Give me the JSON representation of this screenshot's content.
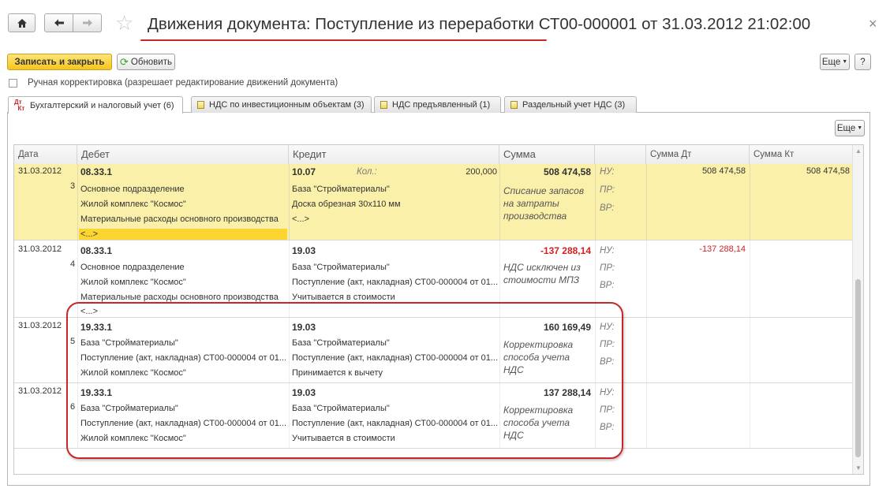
{
  "window": {
    "title": "Движения документа: Поступление из переработки СТ00-000001 от 31.03.2012 21:02:00",
    "home_icon": "home-icon",
    "back_icon": "arrow-left-icon",
    "forward_icon": "arrow-right-icon",
    "favorite_icon": "star-icon",
    "close_icon": "close-icon",
    "accent_color": "#c62828"
  },
  "toolbar": {
    "save_close_label": "Записать и закрыть",
    "refresh_label": "Обновить",
    "more_label": "Еще",
    "help_label": "?"
  },
  "manual_edit": {
    "label": "Ручная корректировка (разрешает редактирование движений документа)",
    "checked": false
  },
  "tabs": [
    {
      "label": "Бухгалтерский и налоговый учет (6)",
      "icon": "dt-kt-icon",
      "active": true
    },
    {
      "label": "НДС по инвестиционным объектам (3)",
      "icon": "register-icon",
      "active": false
    },
    {
      "label": "НДС предъявленный (1)",
      "icon": "register-icon",
      "active": false
    },
    {
      "label": "Раздельный учет НДС (3)",
      "icon": "register-icon",
      "active": false
    }
  ],
  "grid": {
    "more_label": "Еще",
    "columns": {
      "date": "Дата",
      "debit": "Дебет",
      "credit": "Кредит",
      "sum": "Сумма",
      "sum_dt": "Сумма Дт",
      "sum_kt": "Сумма Кт"
    },
    "rows": [
      {
        "date": "31.03.2012",
        "num": "3",
        "debit_account": "08.33.1",
        "debit_sub": [
          "Основное подразделение",
          "Жилой комплекс \"Космос\"",
          "Материальные расходы основного производства",
          "<...>"
        ],
        "credit_account": "10.07",
        "credit_qty_label": "Кол.:",
        "credit_qty": "200,000",
        "credit_sub": [
          "База \"Стройматериалы\"",
          "Доска обрезная 30х110 мм",
          "<...>"
        ],
        "sum": "508 474,58",
        "content": "Списание запасов на затраты производства",
        "tax_labels": [
          "НУ:",
          "ПР:",
          "ВР:"
        ],
        "sum_dt": "508 474,58",
        "sum_kt": "508 474,58"
      },
      {
        "date": "31.03.2012",
        "num": "4",
        "debit_account": "08.33.1",
        "debit_sub": [
          "Основное подразделение",
          "Жилой комплекс \"Космос\"",
          "Материальные расходы основного производства",
          "<...>"
        ],
        "credit_account": "19.03",
        "credit_sub": [
          "База \"Стройматериалы\"",
          "Поступление (акт, накладная) СТ00-000004 от 01...",
          "Учитывается в стоимости"
        ],
        "sum": "-137 288,14",
        "content": "НДС исключен из стоимости МПЗ",
        "tax_labels": [
          "НУ:",
          "ПР:",
          "ВР:"
        ],
        "sum_dt": "-137 288,14",
        "sum_kt": ""
      },
      {
        "date": "31.03.2012",
        "num": "5",
        "debit_account": "19.33.1",
        "debit_sub": [
          "База \"Стройматериалы\"",
          "Поступление (акт, накладная) СТ00-000004 от 01...",
          "Жилой комплекс \"Космос\""
        ],
        "credit_account": "19.03",
        "credit_sub": [
          "База \"Стройматериалы\"",
          "Поступление (акт, накладная) СТ00-000004 от 01...",
          "Принимается к вычету"
        ],
        "sum": "160 169,49",
        "content": "Корректировка способа учета НДС",
        "tax_labels": [
          "НУ:",
          "ПР:",
          "ВР:"
        ],
        "sum_dt": "",
        "sum_kt": ""
      },
      {
        "date": "31.03.2012",
        "num": "6",
        "debit_account": "19.33.1",
        "debit_sub": [
          "База \"Стройматериалы\"",
          "Поступление (акт, накладная) СТ00-000004 от 01...",
          "Жилой комплекс \"Космос\""
        ],
        "credit_account": "19.03",
        "credit_sub": [
          "База \"Стройматериалы\"",
          "Поступление (акт, накладная) СТ00-000004 от 01...",
          "Учитывается в стоимости"
        ],
        "sum": "137 288,14",
        "content": "Корректировка способа учета НДС",
        "tax_labels": [
          "НУ:",
          "ПР:",
          "ВР:"
        ],
        "sum_dt": "",
        "sum_kt": ""
      }
    ]
  }
}
